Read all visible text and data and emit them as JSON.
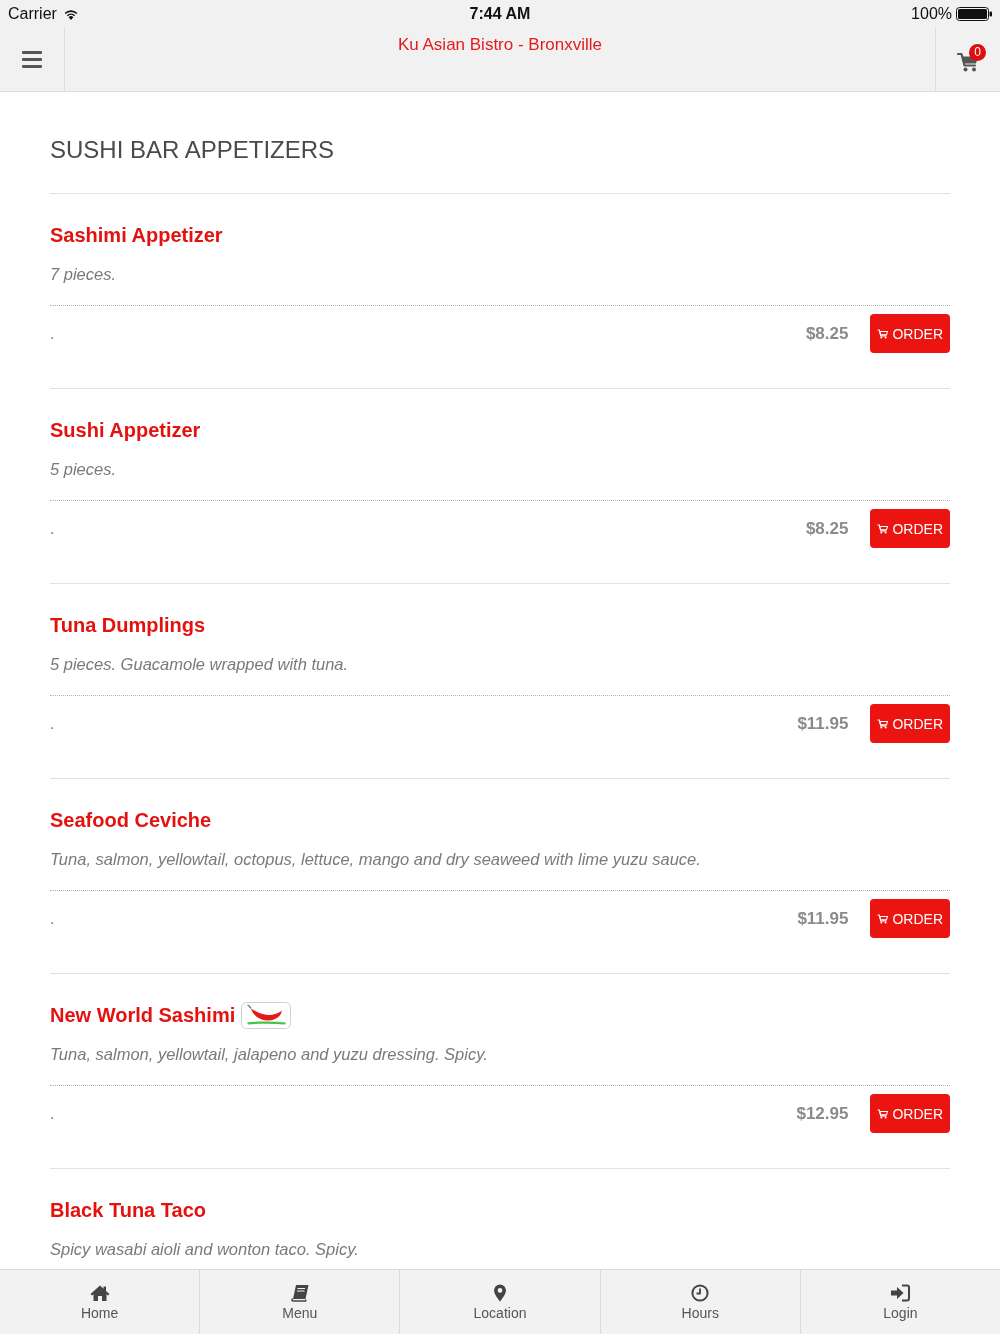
{
  "status_bar": {
    "carrier": "Carrier",
    "time": "7:44 AM",
    "battery": "100%"
  },
  "header": {
    "title": "Ku Asian Bistro - Bronxville",
    "cart_count": "0"
  },
  "section": {
    "title": "SUSHI BAR APPETIZERS",
    "items": [
      {
        "name": "Sashimi Appetizer",
        "spicy": false,
        "description": "7 pieces.",
        "option": ".",
        "price": "$8.25",
        "button": "ORDER"
      },
      {
        "name": "Sushi Appetizer",
        "spicy": false,
        "description": "5 pieces.",
        "option": ".",
        "price": "$8.25",
        "button": "ORDER"
      },
      {
        "name": "Tuna Dumplings",
        "spicy": false,
        "description": "5 pieces. Guacamole wrapped with tuna.",
        "option": ".",
        "price": "$11.95",
        "button": "ORDER"
      },
      {
        "name": "Seafood Ceviche",
        "spicy": false,
        "description": "Tuna, salmon, yellowtail, octopus, lettuce, mango and dry seaweed with lime yuzu sauce.",
        "option": ".",
        "price": "$11.95",
        "button": "ORDER"
      },
      {
        "name": "New World Sashimi",
        "spicy": true,
        "description": "Tuna, salmon, yellowtail, jalapeno and yuzu dressing. Spicy.",
        "option": ".",
        "price": "$12.95",
        "button": "ORDER"
      },
      {
        "name": "Black Tuna Taco",
        "spicy": false,
        "description": "Spicy wasabi aioli and wonton taco. Spicy."
      }
    ]
  },
  "tab_bar": [
    {
      "kind": "home",
      "label": "Home",
      "selected": false
    },
    {
      "kind": "menu",
      "label": "Menu",
      "selected": false
    },
    {
      "kind": "location",
      "label": "Location",
      "selected": false
    },
    {
      "kind": "hours",
      "label": "Hours",
      "selected": false
    },
    {
      "kind": "login",
      "label": "Login",
      "selected": false
    }
  ]
}
